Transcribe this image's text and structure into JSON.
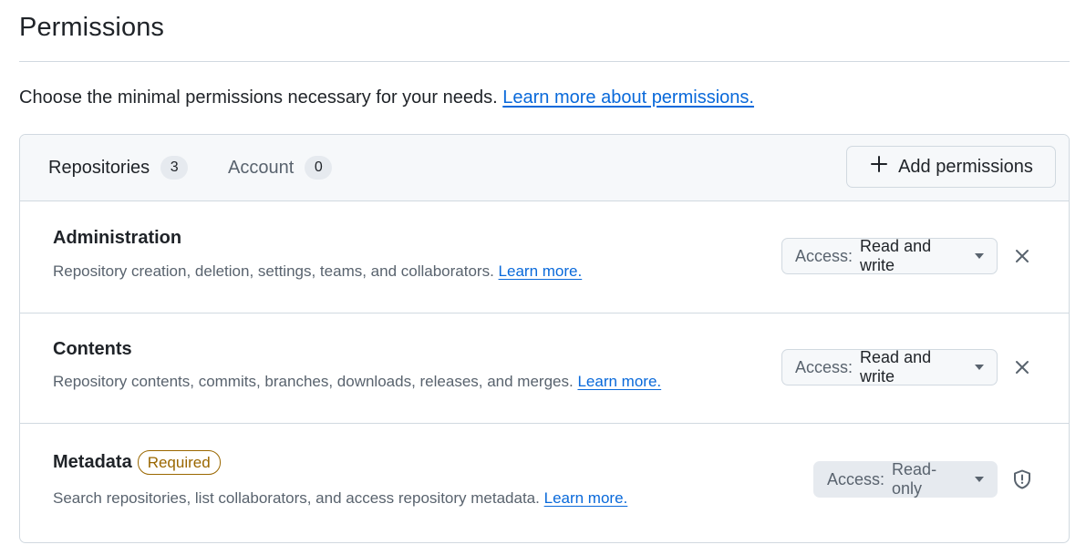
{
  "page": {
    "title": "Permissions",
    "intro_text": "Choose the minimal permissions necessary for your needs.",
    "intro_link": "Learn more about permissions."
  },
  "tabs": [
    {
      "label": "Repositories",
      "count": "3",
      "active": true
    },
    {
      "label": "Account",
      "count": "0",
      "active": false
    }
  ],
  "toolbar": {
    "add_label": "Add permissions",
    "add_icon": "plus-icon"
  },
  "permissions": [
    {
      "name": "Administration",
      "description": "Repository creation, deletion, settings, teams, and collaborators.",
      "link": "Learn more.",
      "access_label": "Access:",
      "access_value": "Read and write",
      "removable": true
    },
    {
      "name": "Contents",
      "description": "Repository contents, commits, branches, downloads, releases, and merges.",
      "link": "Learn more.",
      "access_label": "Access:",
      "access_value": "Read and write",
      "removable": true
    },
    {
      "name": "Metadata",
      "badge": "Required",
      "description": "Search repositories, list collaborators, and access repository metadata.",
      "link": "Learn more.",
      "access_label": "Access:",
      "access_value": "Read-only",
      "removable": false
    }
  ],
  "colors": {
    "link": "#0969da",
    "required": "#9a6700",
    "border": "#d1d9e0",
    "header_bg": "#f6f8fa"
  }
}
